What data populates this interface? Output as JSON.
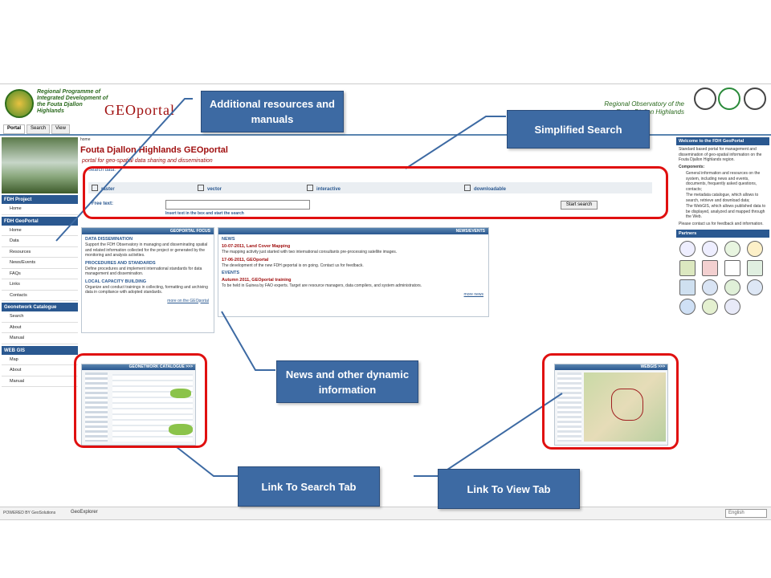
{
  "header": {
    "program_text": "Regional Programme of Integrated Development of the Fouta Djallon Highlands",
    "app_title": "GEOportal",
    "observatory_text": "Regional Observatory of the Fouta Djallon Highlands"
  },
  "tabs": [
    {
      "label": "Portal"
    },
    {
      "label": "Search"
    },
    {
      "label": "View"
    }
  ],
  "nav": {
    "fdh_project": {
      "title": "FDH Project",
      "items": [
        "Home"
      ]
    },
    "fdh_geoportal": {
      "title": "FDH GeoPortal",
      "items": [
        "Home",
        "Data",
        "Resources",
        "News/Events",
        "FAQs",
        "Links",
        "Contacts"
      ]
    },
    "geonetwork": {
      "title": "Geonetwork Catalogue",
      "items": [
        "Search",
        "About",
        "Manual"
      ]
    },
    "webgis": {
      "title": "WEB GIS",
      "items": [
        "Map",
        "About",
        "Manual"
      ]
    }
  },
  "main": {
    "breadcrumb": "home",
    "title": "Fouta Djallon Highlands GEOportal",
    "subtitle": "portal for geo-spatial data sharing and dissemination",
    "search": {
      "label": "Search data:",
      "options": [
        "raster",
        "vector",
        "interactive",
        "downloadable"
      ],
      "free_text_label": "Free text:",
      "hint": "Insert text in the box and start the search",
      "button": "Start search"
    },
    "focus": {
      "header": "GEOPORTAL FOCUS",
      "sections": [
        {
          "title": "DATA DISSEMINATION",
          "text": "Support the FDH Observatory in managing and disseminating spatial and related information collected for the project or generated by the monitoring and analysis activities."
        },
        {
          "title": "PROCEDURES AND STANDARDS",
          "text": "Define procedures and implement international standards for data management and dissemination."
        },
        {
          "title": "LOCAL CAPACITY BUILDING",
          "text": "Organize and conduct trainings in collecting, formatting and archiving data in compliance with adopted standards."
        }
      ],
      "more": "more on the GEOportal"
    },
    "news": {
      "header": "NEWS/EVENTS",
      "news_label": "NEWS",
      "items": [
        {
          "title": "10-07-2011, Land Cover Mapping",
          "text": "The mapping activity just started with two international consultants pre-processing satellite images."
        },
        {
          "title": "17-06-2011, GEOportal",
          "text": "The development of the new FDH geportal is on going. Contact us for feedback."
        }
      ],
      "events_label": "EVENTS",
      "event": {
        "title": "Autumn 2011, GEOportal training",
        "text": "To be held in Guinea by FAO experts. Target are resource managers, data compilers, and system administrators."
      },
      "more": "more news"
    },
    "catalogue_header": "GEONETWORK CATALOGUE >>>",
    "webgis_header": "WEBGIS >>>"
  },
  "right": {
    "welcome_title": "Welcome to the FDH GeoPortal",
    "intro": "Standard based portal for management and dissemination of geo-spatial information on the Fouta Djallon Highlands region.",
    "components_label": "Components:",
    "bullets": [
      "General information and resources on the system, including news and events, documents, frequently asked questions, contacts;",
      "The metadata catalogue, which allows to search, retrieve and download data;",
      "The WebGIS, which allows published data to be displayed, analyzed and mapped through the Web."
    ],
    "contact": "Please contact us for feedback and information.",
    "partners_title": "Partners"
  },
  "partner_logos": {
    "unep": "UNEP",
    "gef": "gef",
    "fao": "FAO"
  },
  "footer": {
    "powered": "POWERED BY GeoSolutions",
    "geoexplorer": "GeoExplorer",
    "language": "English"
  },
  "callouts": {
    "resources": "Additional resources and manuals",
    "search": "Simplified Search",
    "news": "News and other dynamic information",
    "search_tab": "Link To Search Tab",
    "view_tab": "Link To View Tab"
  },
  "colors": {
    "accent": "#2a5890",
    "brand_red": "#a01010",
    "callout": "#3d6aa3",
    "highlight": "#e01010"
  }
}
